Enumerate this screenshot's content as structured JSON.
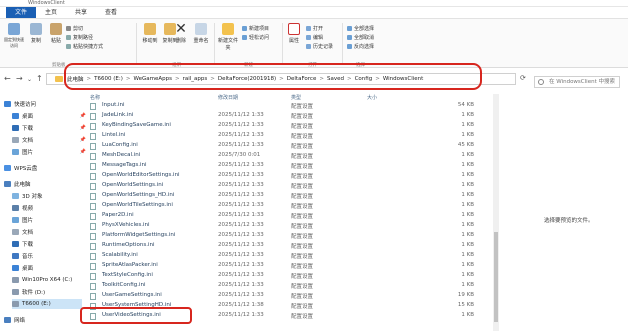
{
  "window": {
    "title": "WindowsClient"
  },
  "menu_tabs": [
    "文件",
    "主页",
    "共享",
    "查看"
  ],
  "ribbon": {
    "clipboard": {
      "pin_label": "固定到快速访问",
      "copy_label": "复制",
      "paste_label": "粘贴",
      "cut_label": "剪切",
      "copy_path_label": "复制路径",
      "paste_shortcut_label": "粘贴快捷方式",
      "group_label": "剪贴板"
    },
    "organize": {
      "move_to_label": "移动到",
      "copy_to_label": "复制到",
      "delete_label": "删除",
      "rename_label": "重命名",
      "group_label": "组织"
    },
    "new": {
      "new_folder_label": "新建文件夹",
      "new_item_label": "新建项目",
      "easy_access_label": "轻松访问",
      "group_label": "新建"
    },
    "open": {
      "properties_label": "属性",
      "open_label": "打开",
      "edit_label": "编辑",
      "history_label": "历史记录",
      "group_label": "打开"
    },
    "select": {
      "select_all_label": "全部选择",
      "select_none_label": "全部取消",
      "invert_label": "反向选择",
      "group_label": "选择"
    }
  },
  "address": {
    "crumbs": [
      "此电脑",
      "T6600 (E:)",
      "WeGameApps",
      "rail_apps",
      "DeltaForce(2001918)",
      "DeltaForce",
      "Saved",
      "Config",
      "WindowsClient"
    ],
    "separator": ">"
  },
  "search": {
    "placeholder": "在 WindowsClient 中搜索"
  },
  "sidebar": {
    "items": [
      {
        "label": "快速访问",
        "icon": "star-icon"
      },
      {
        "label": "桌面",
        "icon": "desktop-icon",
        "pinned": true
      },
      {
        "label": "下载",
        "icon": "download-icon",
        "pinned": true
      },
      {
        "label": "文档",
        "icon": "document-icon",
        "pinned": true
      },
      {
        "label": "图片",
        "icon": "picture-icon",
        "pinned": true
      },
      {
        "label": "WPS云盘",
        "icon": "cloud-icon"
      },
      {
        "label": "此电脑",
        "icon": "computer-icon"
      },
      {
        "label": "3D 对象",
        "icon": "cube-icon"
      },
      {
        "label": "视频",
        "icon": "video-icon"
      },
      {
        "label": "图片",
        "icon": "picture-icon"
      },
      {
        "label": "文档",
        "icon": "document-icon"
      },
      {
        "label": "下载",
        "icon": "download-icon"
      },
      {
        "label": "音乐",
        "icon": "music-icon"
      },
      {
        "label": "桌面",
        "icon": "desktop-icon"
      },
      {
        "label": "Win10Pro X64 (C:)",
        "icon": "drive-icon"
      },
      {
        "label": "软件 (D:)",
        "icon": "drive-icon"
      },
      {
        "label": "T6600 (E:)",
        "icon": "drive-icon",
        "selected": true
      },
      {
        "label": "网络",
        "icon": "network-icon"
      }
    ]
  },
  "columns": {
    "name": "名称",
    "date": "修改日期",
    "type": "类型",
    "size": "大小"
  },
  "files": [
    {
      "name": "Input.ini",
      "date": "",
      "type": "配置设置",
      "size": "54 KB"
    },
    {
      "name": "JadeLink.ini",
      "date": "2025/11/12 1:33",
      "type": "配置设置",
      "size": "1 KB"
    },
    {
      "name": "KeyBindingSaveGame.ini",
      "date": "2025/11/12 1:33",
      "type": "配置设置",
      "size": "1 KB"
    },
    {
      "name": "Lintel.ini",
      "date": "2025/11/12 1:33",
      "type": "配置设置",
      "size": "1 KB"
    },
    {
      "name": "LuaConfig.ini",
      "date": "2025/11/12 1:33",
      "type": "配置设置",
      "size": "45 KB"
    },
    {
      "name": "MeshDecal.ini",
      "date": "2025/7/30 0:01",
      "type": "配置设置",
      "size": "1 KB"
    },
    {
      "name": "MessageTags.ini",
      "date": "2025/11/12 1:33",
      "type": "配置设置",
      "size": "1 KB"
    },
    {
      "name": "OpenWorldEditorSettings.ini",
      "date": "2025/11/12 1:33",
      "type": "配置设置",
      "size": "1 KB"
    },
    {
      "name": "OpenWorldSettings.ini",
      "date": "2025/11/12 1:33",
      "type": "配置设置",
      "size": "1 KB"
    },
    {
      "name": "OpenWorldSettings_HD.ini",
      "date": "2025/11/12 1:33",
      "type": "配置设置",
      "size": "1 KB"
    },
    {
      "name": "OpenWorldTileSettings.ini",
      "date": "2025/11/12 1:33",
      "type": "配置设置",
      "size": "1 KB"
    },
    {
      "name": "Paper2D.ini",
      "date": "2025/11/12 1:33",
      "type": "配置设置",
      "size": "1 KB"
    },
    {
      "name": "PhysXVehicles.ini",
      "date": "2025/11/12 1:33",
      "type": "配置设置",
      "size": "1 KB"
    },
    {
      "name": "PlatformWidgetSettings.ini",
      "date": "2025/11/12 1:33",
      "type": "配置设置",
      "size": "1 KB"
    },
    {
      "name": "RuntimeOptions.ini",
      "date": "2025/11/12 1:33",
      "type": "配置设置",
      "size": "1 KB"
    },
    {
      "name": "Scalability.ini",
      "date": "2025/11/12 1:33",
      "type": "配置设置",
      "size": "1 KB"
    },
    {
      "name": "SpriteAtlasPacker.ini",
      "date": "2025/11/12 1:33",
      "type": "配置设置",
      "size": "1 KB"
    },
    {
      "name": "TextStyleConfig.ini",
      "date": "2025/11/12 1:33",
      "type": "配置设置",
      "size": "1 KB"
    },
    {
      "name": "ToolkitConfig.ini",
      "date": "2025/11/12 1:33",
      "type": "配置设置",
      "size": "1 KB"
    },
    {
      "name": "UserGameSettings.ini",
      "date": "2025/11/12 1:33",
      "type": "配置设置",
      "size": "19 KB"
    },
    {
      "name": "UserSystemSettingHD.ini",
      "date": "2025/11/12 1:38",
      "type": "配置设置",
      "size": "15 KB"
    },
    {
      "name": "UserVideoSettings.ini",
      "date": "2025/11/12 1:33",
      "type": "配置设置",
      "size": "1 KB"
    }
  ],
  "preview": {
    "message": "选择要预览的文件。"
  },
  "colors": {
    "accent": "#1a5fb4",
    "highlight": "#d7261e",
    "folder": "#f3c24e",
    "selected": "#cce4f7"
  }
}
